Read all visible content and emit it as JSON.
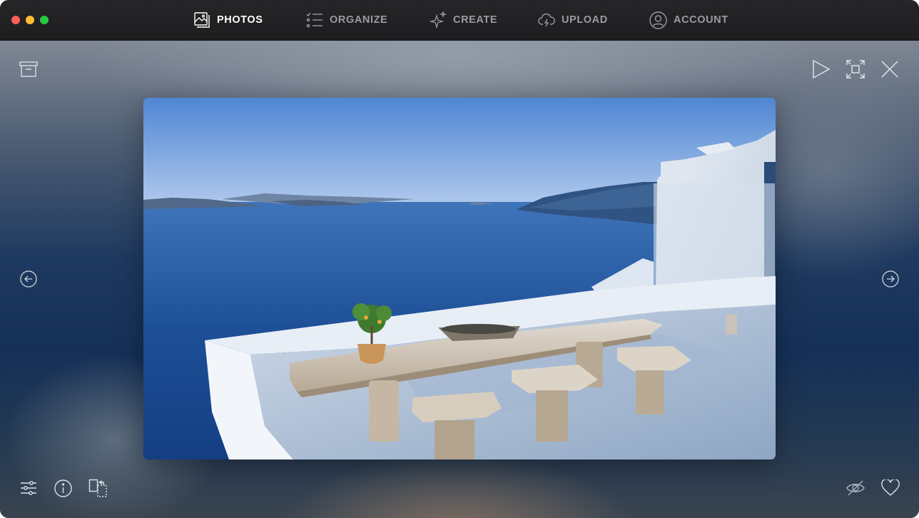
{
  "window": {
    "traffic_lights": [
      "close",
      "minimize",
      "zoom"
    ],
    "colors": {
      "close": "#fe5f57",
      "minimize": "#febc2e",
      "zoom": "#28c840"
    }
  },
  "nav": {
    "items": [
      {
        "label": "PHOTOS",
        "icon": "photos-icon",
        "active": true
      },
      {
        "label": "ORGANIZE",
        "icon": "checklist-icon",
        "active": false
      },
      {
        "label": "CREATE",
        "icon": "sparkle-icon",
        "active": false
      },
      {
        "label": "UPLOAD",
        "icon": "cloud-upload-icon",
        "active": false
      },
      {
        "label": "ACCOUNT",
        "icon": "user-icon",
        "active": false
      }
    ],
    "active_color": "#ffffff",
    "inactive_color": "#9b9ba0"
  },
  "viewer": {
    "top_left": [
      "archive-icon"
    ],
    "top_right": [
      "play-icon",
      "fullscreen-icon",
      "close-icon"
    ],
    "sides": [
      "arrow-left-icon",
      "arrow-right-icon"
    ],
    "bottom_left": [
      "adjustments-icon",
      "info-icon",
      "compare-icon"
    ],
    "bottom_right": [
      "hide-icon",
      "heart-icon"
    ],
    "photo_subject": "terrace-sea-view"
  }
}
